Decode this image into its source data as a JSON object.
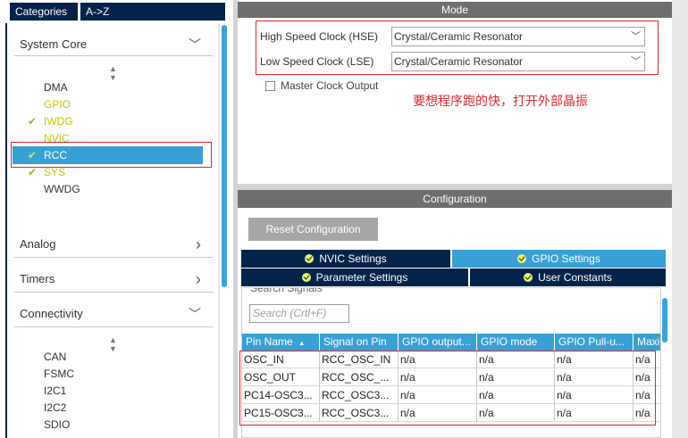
{
  "left_tabs": {
    "categories": "Categories",
    "az": "A->Z"
  },
  "system_core": {
    "header": "System Core",
    "items": [
      {
        "label": "DMA",
        "state": "normal",
        "checked": false
      },
      {
        "label": "GPIO",
        "state": "yellow",
        "checked": false
      },
      {
        "label": "IWDG",
        "state": "yellow",
        "checked": true
      },
      {
        "label": "NVIC",
        "state": "yellow",
        "checked": false
      },
      {
        "label": "RCC",
        "state": "selected",
        "checked": true
      },
      {
        "label": "SYS",
        "state": "yellow",
        "checked": true
      },
      {
        "label": "WWDG",
        "state": "normal",
        "checked": false
      }
    ]
  },
  "analog": {
    "header": "Analog"
  },
  "timers": {
    "header": "Timers"
  },
  "connectivity": {
    "header": "Connectivity",
    "items": [
      "CAN",
      "FSMC",
      "I2C1",
      "I2C2",
      "SDIO"
    ]
  },
  "mode": {
    "title": "Mode",
    "hse_label": "High Speed Clock (HSE)",
    "hse_value": "Crystal/Ceramic Resonator",
    "lse_label": "Low Speed Clock (LSE)",
    "lse_value": "Crystal/Ceramic Resonator",
    "mco_label": "Master Clock Output",
    "annotation": "要想程序跑的快，打开外部晶振"
  },
  "configuration": {
    "title": "Configuration",
    "reset_label": "Reset Configuration",
    "tabs": {
      "nvic": "NVIC Settings",
      "gpio": "GPIO Settings",
      "param": "Parameter Settings",
      "user": "User Constants"
    },
    "search_signals_label": "Search Signals",
    "search_placeholder": "Search (Crtl+F)",
    "columns": [
      "Pin Name",
      "Signal on Pin",
      "GPIO output...",
      "GPIO mode",
      "GPIO Pull-u...",
      "Maxi"
    ],
    "rows": [
      [
        "OSC_IN",
        "RCC_OSC_IN",
        "n/a",
        "n/a",
        "n/a",
        "n/a"
      ],
      [
        "OSC_OUT",
        "RCC_OSC_...",
        "n/a",
        "n/a",
        "n/a",
        "n/a"
      ],
      [
        "PC14-OSC3...",
        "RCC_OSC3...",
        "n/a",
        "n/a",
        "n/a",
        "n/a"
      ],
      [
        "PC15-OSC3...",
        "RCC_OSC3...",
        "n/a",
        "n/a",
        "n/a",
        "n/a"
      ]
    ]
  },
  "icons": {
    "check": "✔",
    "chevron_down": "﹀",
    "chevron_right": "›",
    "sort_up": "▲",
    "dropdown": "﹀"
  }
}
